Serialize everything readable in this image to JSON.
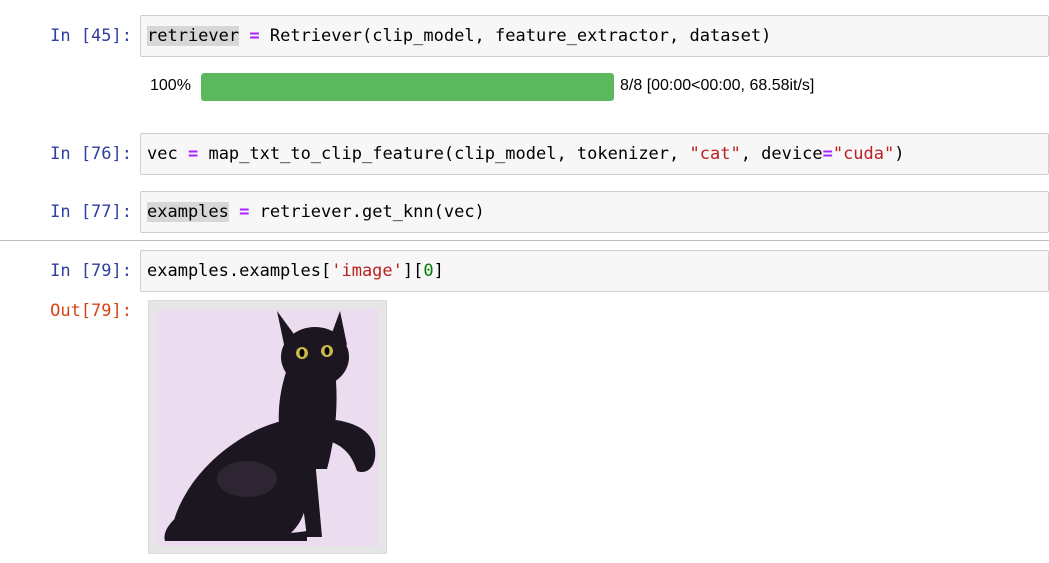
{
  "cells": [
    {
      "prompt": "In [45]:",
      "code": {
        "var": "retriever",
        "op": "=",
        "rest": " Retriever(clip_model, feature_extractor, dataset)"
      },
      "progress": {
        "percent_label": "100%",
        "value": 1.0,
        "info": "8/8 [00:00<00:00, 68.58it/s]",
        "bar_color": "#5cb85c"
      }
    },
    {
      "prompt": "In [76]:",
      "code": {
        "var": "vec",
        "op": "=",
        "part1": " map_txt_to_clip_feature(clip_model, tokenizer, ",
        "str1": "\"cat\"",
        "part2": ", device",
        "op2": "=",
        "str2": "\"cuda\"",
        "part3": ")"
      }
    },
    {
      "prompt": "In [77]:",
      "code": {
        "var": "examples",
        "op": "=",
        "rest": " retriever.get_knn(vec)"
      }
    },
    {
      "prompt": "In [79]:",
      "code": {
        "part1": "examples.examples[",
        "str1": "'image'",
        "part2": "][",
        "num1": "0",
        "part3": "]"
      },
      "out_prompt": "Out[79]:",
      "output_image": {
        "subject": "black-cat-image",
        "background": "#ecdcf0"
      }
    }
  ],
  "colors": {
    "prompt_in": "#303F9F",
    "prompt_out": "#D84315",
    "keyword_op": "#aa22ff",
    "string": "#ba2121",
    "number": "#008000"
  }
}
